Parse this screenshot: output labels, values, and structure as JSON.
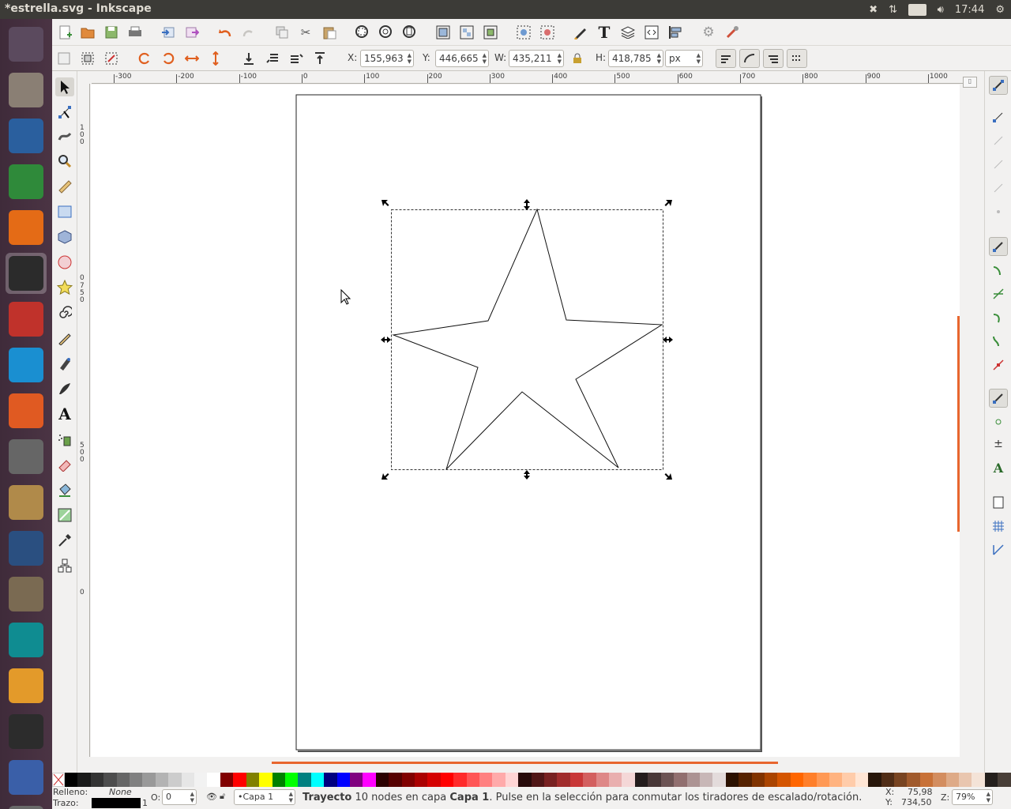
{
  "window": {
    "title": "*estrella.svg - Inkscape"
  },
  "tray": {
    "lang": "Es",
    "clock": "17:44"
  },
  "launcher": {
    "items": [
      {
        "name": "ubuntu-dash-icon",
        "color": "#5b4a5e"
      },
      {
        "name": "files-icon",
        "color": "#8a7f74"
      },
      {
        "name": "writer-icon",
        "color": "#2a5f9e"
      },
      {
        "name": "calc-icon",
        "color": "#2f8a3a"
      },
      {
        "name": "firefox-icon",
        "color": "#e46b16"
      },
      {
        "name": "inkscape-icon",
        "color": "#2b2b2b"
      },
      {
        "name": "fritzing-icon",
        "color": "#c0322b"
      },
      {
        "name": "codeblocks-icon",
        "color": "#1a8fd1"
      },
      {
        "name": "software-center-icon",
        "color": "#e05a22"
      },
      {
        "name": "system-settings-icon",
        "color": "#666666"
      },
      {
        "name": "archive-manager-icon",
        "color": "#b08a4a"
      },
      {
        "name": "blender-icon",
        "color": "#2a4f80"
      },
      {
        "name": "gimp-icon",
        "color": "#7a6a52"
      },
      {
        "name": "arduino-icon",
        "color": "#0f8c91"
      },
      {
        "name": "scratch-icon",
        "color": "#e39a2a"
      },
      {
        "name": "terminal-icon",
        "color": "#2c2c2c"
      },
      {
        "name": "workspace-switcher-icon",
        "color": "#3a5fa8"
      },
      {
        "name": "trash-icon",
        "color": "#6a6a6a"
      }
    ]
  },
  "toolcontrols": {
    "x_label": "X:",
    "x_value": "155,963",
    "y_label": "Y:",
    "y_value": "446,665",
    "w_label": "W:",
    "w_value": "435,211",
    "h_label": "H:",
    "h_value": "418,785",
    "unit": "px"
  },
  "rulers": {
    "h_ticks": [
      "-300",
      "-200",
      "-100",
      "0",
      "100",
      "200",
      "300",
      "400",
      "500",
      "600",
      "700",
      "800",
      "900",
      "1000"
    ],
    "v_ticks": [
      "1\n0\n0",
      "0",
      "7\n5\n0",
      "5\n0\n0",
      "0"
    ]
  },
  "palette": {
    "colors": [
      "#000000",
      "#1a1a1a",
      "#333333",
      "#4d4d4d",
      "#666666",
      "#808080",
      "#999999",
      "#b3b3b3",
      "#cccccc",
      "#e6e6e6",
      "#f2f2f2",
      "#ffffff",
      "#800000",
      "#ff0000",
      "#808000",
      "#ffff00",
      "#008000",
      "#00ff00",
      "#008080",
      "#00ffff",
      "#000080",
      "#0000ff",
      "#800080",
      "#ff00ff",
      "#2b0000",
      "#550000",
      "#800000",
      "#aa0000",
      "#d40000",
      "#ff0000",
      "#ff2a2a",
      "#ff5555",
      "#ff8080",
      "#ffaaaa",
      "#ffd5d5",
      "#280b0b",
      "#501616",
      "#782121",
      "#a02c2c",
      "#c83737",
      "#d35f5f",
      "#de8787",
      "#e9afaf",
      "#f4d7d7",
      "#241c1c",
      "#483737",
      "#6c5353",
      "#916f6f",
      "#ac9393",
      "#c8b7b7",
      "#e3dbdb",
      "#2b1100",
      "#552200",
      "#803300",
      "#aa4400",
      "#d45500",
      "#ff6600",
      "#ff7f2a",
      "#ff9955",
      "#ffb380",
      "#ffccaa",
      "#ffe6d5",
      "#28170b",
      "#502d16",
      "#784421",
      "#a05a2c",
      "#c87137",
      "#d38d5f",
      "#deaa87",
      "#e9c6af",
      "#f4e3d7",
      "#241f1c",
      "#483e37"
    ]
  },
  "status": {
    "fill_label": "Relleno:",
    "fill_value": "None",
    "stroke_label": "Trazo:",
    "stroke_width": "1",
    "opacity_label": "O:",
    "opacity_value": "0",
    "layer": "•Capa 1",
    "message_bold": "Trayecto",
    "message_mid": " 10 nodes en capa ",
    "message_layer": "Capa 1",
    "message_rest": ". Pulse en la selección para conmutar los tiradores de escalado/rotación.",
    "cursor_x_label": "X:",
    "cursor_x": "75,98",
    "cursor_y_label": "Y:",
    "cursor_y": "734,50",
    "zoom_label": "Z:",
    "zoom_value": "79%"
  }
}
